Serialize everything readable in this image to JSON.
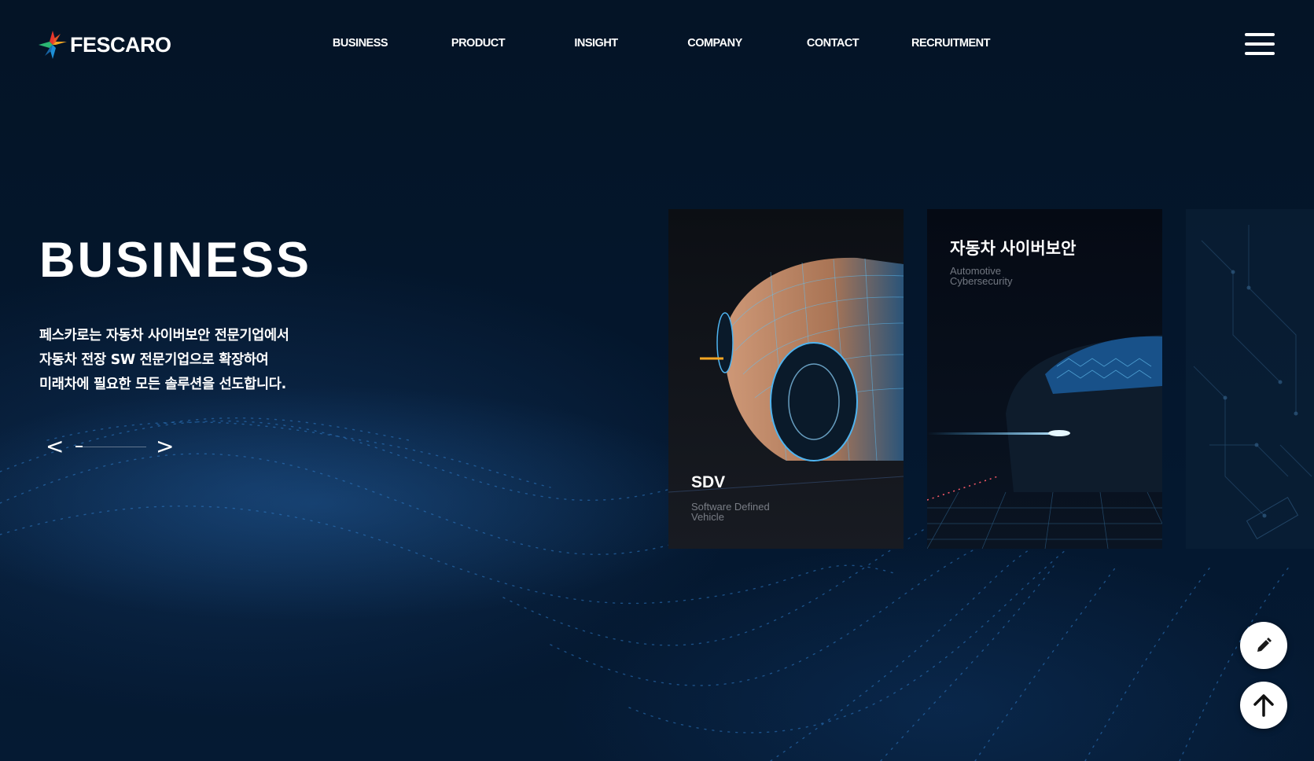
{
  "brand": {
    "name": "FESCARO"
  },
  "nav": {
    "items": [
      {
        "label": "BUSINESS"
      },
      {
        "label": "PRODUCT"
      },
      {
        "label": "INSIGHT"
      },
      {
        "label": "COMPANY"
      },
      {
        "label": "CONTACT"
      },
      {
        "label": "RECRUITMENT"
      }
    ],
    "menu_icon": "hamburger-menu-icon"
  },
  "hero": {
    "title": "BUSINESS",
    "description": [
      "페스카로는 자동차 사이버보안 전문기업에서",
      "자동차 전장 SW 전문기업으로 확장하여",
      "미래차에 필요한 모든 솔루션을 선도합니다."
    ],
    "prev_label": "<",
    "next_label": ">",
    "slider_progress": 0.1
  },
  "cards": [
    {
      "title": "SDV",
      "subtitle_lines": [
        "Software Defined",
        "Vehicle"
      ]
    },
    {
      "title": "자동차 사이버보안",
      "subtitle_lines": [
        "Automotive",
        "Cybersecurity"
      ]
    },
    {
      "title": "",
      "subtitle_lines": []
    }
  ],
  "fabs": [
    {
      "icon": "pencil-icon"
    },
    {
      "icon": "arrow-up-icon"
    }
  ],
  "colors": {
    "background": "#04152a",
    "text": "#ffffff",
    "card_sub": "#9aa0ab",
    "car_glow": "#3fb8ff",
    "car_body": "#e8a070",
    "logo_red": "#e8362c",
    "logo_orange": "#f5a623",
    "logo_blue": "#1d8fd6",
    "logo_green": "#2bb673"
  }
}
